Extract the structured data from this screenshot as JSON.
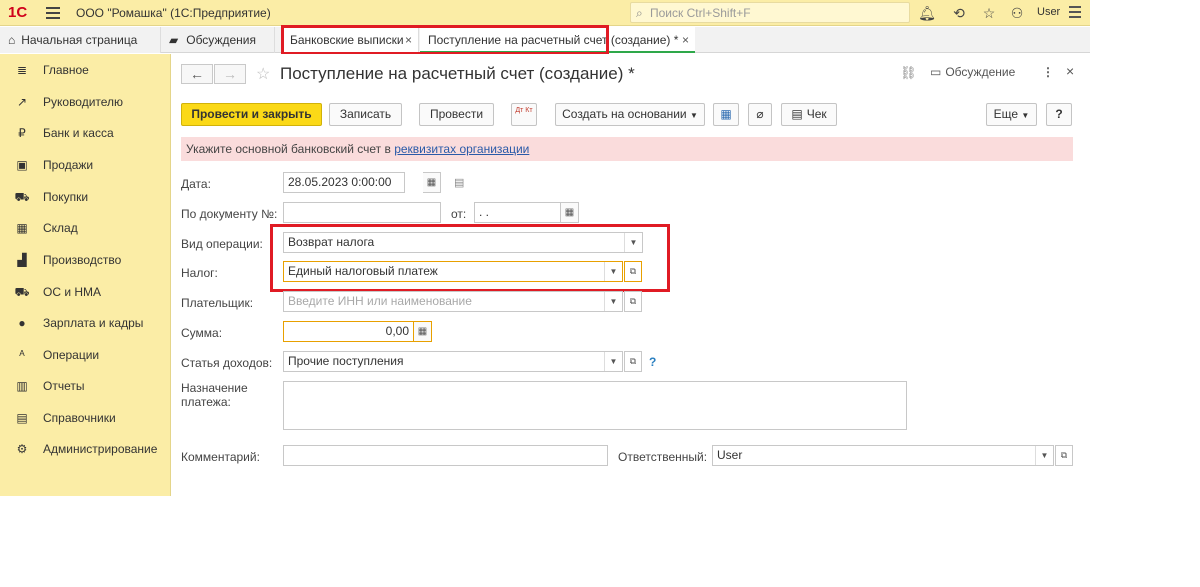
{
  "app": {
    "logo": "1С",
    "title": "ООО \"Ромашка\"  (1С:Предприятие)",
    "search_placeholder": "Поиск Ctrl+Shift+F",
    "user": "User"
  },
  "tabs": {
    "home": "Начальная страница",
    "discussions": "Обсуждения",
    "bank": "Банковские выписки",
    "post": "Поступление на расчетный счет (создание) *"
  },
  "sidebar": {
    "items": [
      {
        "label": "Главное",
        "icon": "≣"
      },
      {
        "label": "Руководителю",
        "icon": "↗"
      },
      {
        "label": "Банк и касса",
        "icon": "₽"
      },
      {
        "label": "Продажи",
        "icon": "▣"
      },
      {
        "label": "Покупки",
        "icon": "⛟"
      },
      {
        "label": "Склад",
        "icon": "▦"
      },
      {
        "label": "Производство",
        "icon": "▟"
      },
      {
        "label": "ОС и НМА",
        "icon": "⛟"
      },
      {
        "label": "Зарплата и кадры",
        "icon": "●"
      },
      {
        "label": "Операции",
        "icon": "ᴬ"
      },
      {
        "label": "Отчеты",
        "icon": "▥"
      },
      {
        "label": "Справочники",
        "icon": "▤"
      },
      {
        "label": "Администрирование",
        "icon": "⚙"
      }
    ]
  },
  "doc": {
    "title": "Поступление на расчетный счет (создание) *",
    "discussion": "Обсуждение"
  },
  "toolbar": {
    "post_close": "Провести и закрыть",
    "save": "Записать",
    "post": "Провести",
    "dtkt": "Дт Кт",
    "create_based": "Создать на основании",
    "check": "Чек",
    "more": "Еще",
    "help": "?"
  },
  "warning": {
    "text": "Укажите основной банковский счет в ",
    "link": "реквизитах организации"
  },
  "form": {
    "date_label": "Дата:",
    "date_value": "28.05.2023  0:00:00",
    "docnum_label": "По документу №:",
    "docnum_value": "",
    "from_label": "от:",
    "from_value": " .  .",
    "optype_label": "Вид операции:",
    "optype_value": "Возврат налога",
    "tax_label": "Налог:",
    "tax_value": "Единый налоговый платеж",
    "payer_label": "Плательщик:",
    "payer_placeholder": "Введите ИНН или наименование",
    "sum_label": "Сумма:",
    "sum_value": "0,00",
    "income_label": "Статья доходов:",
    "income_value": "Прочие поступления",
    "purpose_label": "Назначение платежа:",
    "comment_label": "Комментарий:",
    "responsible_label": "Ответственный:",
    "responsible_value": "User"
  }
}
